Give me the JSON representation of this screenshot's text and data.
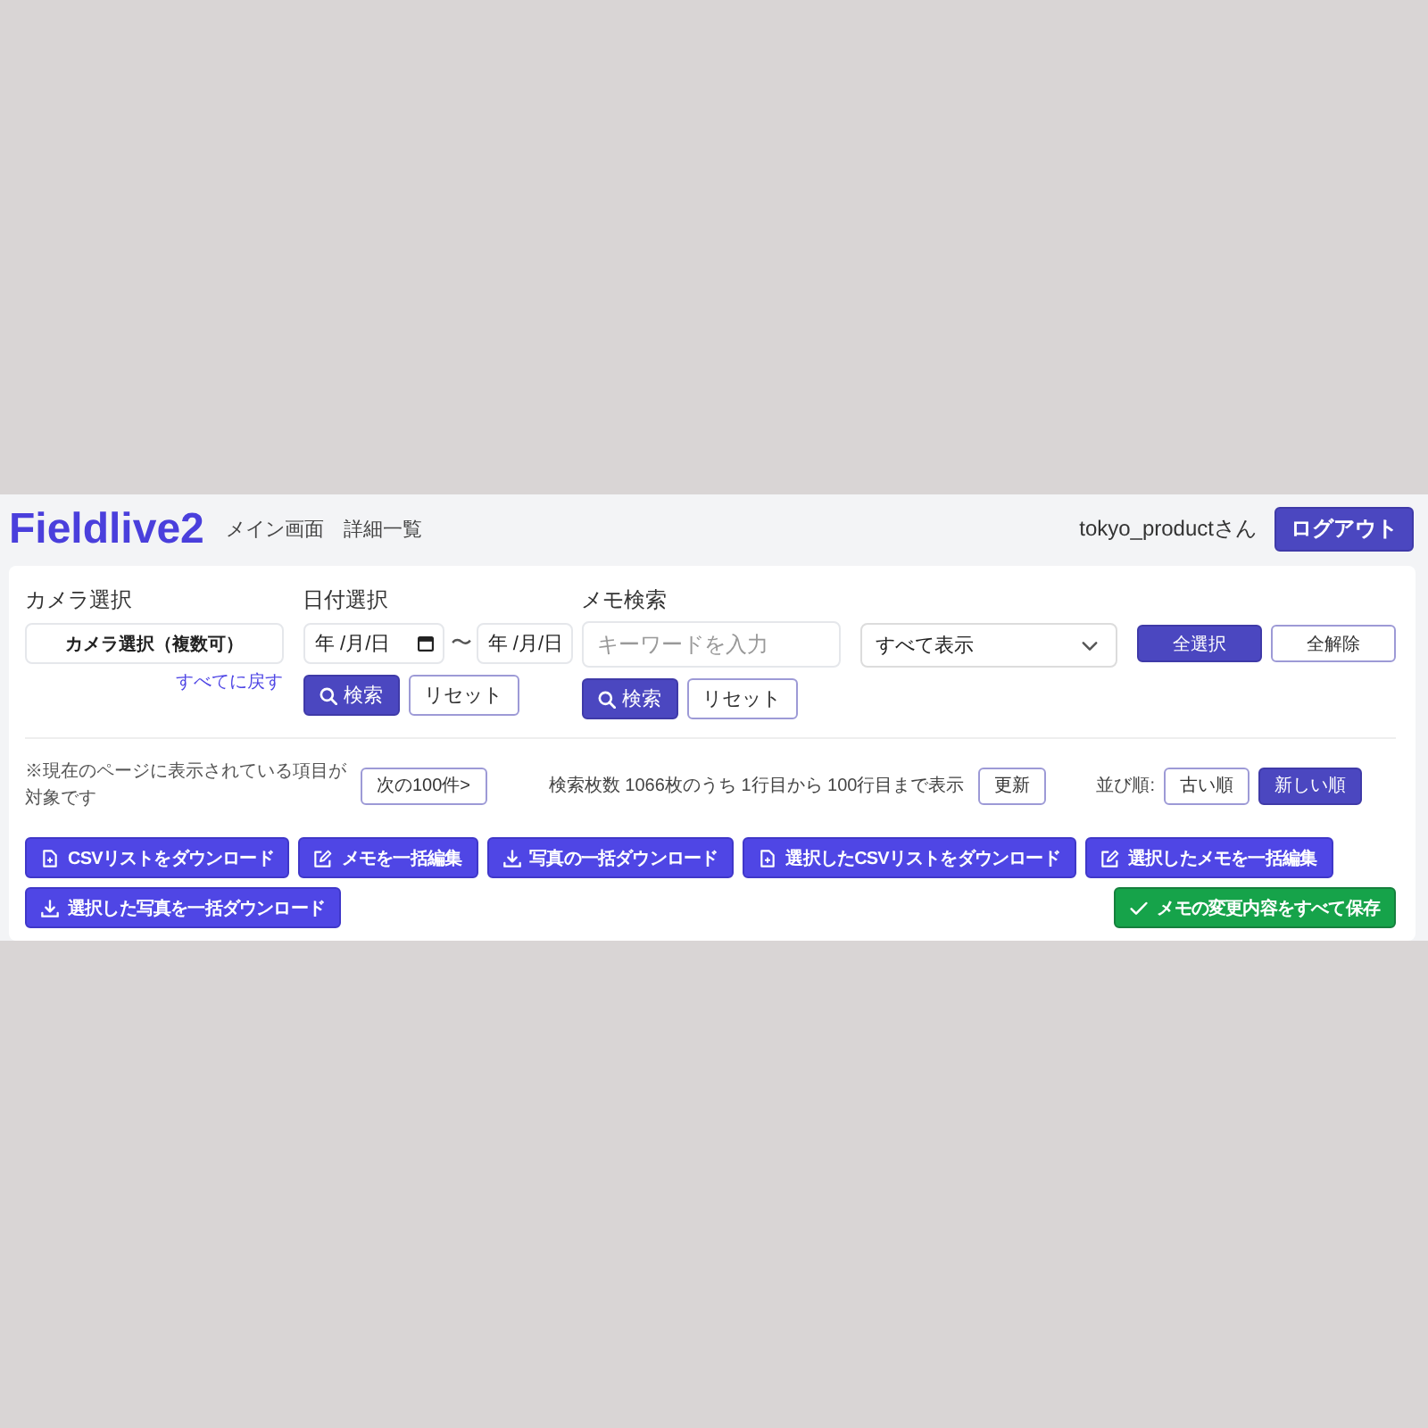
{
  "header": {
    "logo": "Fieldlive2",
    "nav": [
      {
        "label": "メイン画面"
      },
      {
        "label": "詳細一覧"
      }
    ],
    "user": "tokyo_productさん",
    "logout_button": "ログアウト"
  },
  "filters": {
    "camera": {
      "label": "カメラ選択",
      "button": "カメラ選択（複数可）",
      "reset_link": "すべてに戻す"
    },
    "date": {
      "label": "日付選択",
      "fields": [
        {
          "placeholder": "年 /月/日"
        },
        {
          "placeholder": "年 /月/日"
        }
      ],
      "separator": "〜",
      "search_button": "検索",
      "reset_button": "リセット"
    },
    "memo": {
      "label": "メモ検索",
      "placeholder": "キーワードを入力",
      "search_button": "検索",
      "reset_button": "リセット"
    },
    "display_select": {
      "value": "すべて表示"
    },
    "selection_buttons": [
      {
        "label": "全選択",
        "kind": "filled"
      },
      {
        "label": "全解除",
        "kind": "outline"
      }
    ]
  },
  "results": {
    "note": "※現在のページに表示されている項目が対象です",
    "next_button": "次の100件>",
    "summary": "検索枚数 1066枚のうち 1行目から 100行目まで表示",
    "refresh_button": "更新",
    "sort_label": "並び順:",
    "sort_options": [
      {
        "label": "古い順",
        "selected": false
      },
      {
        "label": "新しい順",
        "selected": true
      }
    ]
  },
  "actions": [
    {
      "label": "CSVリストをダウンロード",
      "kind": "file"
    },
    {
      "label": "メモを一括編集",
      "kind": "edit"
    },
    {
      "label": "写真の一括ダウンロード",
      "kind": "download"
    },
    {
      "label": "選択したCSVリストをダウンロード",
      "kind": "file"
    },
    {
      "label": "選択したメモを一括編集",
      "kind": "edit"
    },
    {
      "label": "選択した写真を一括ダウンロード",
      "kind": "download"
    },
    {
      "label": "メモの変更内容をすべて保存",
      "kind": "confirm"
    }
  ]
}
